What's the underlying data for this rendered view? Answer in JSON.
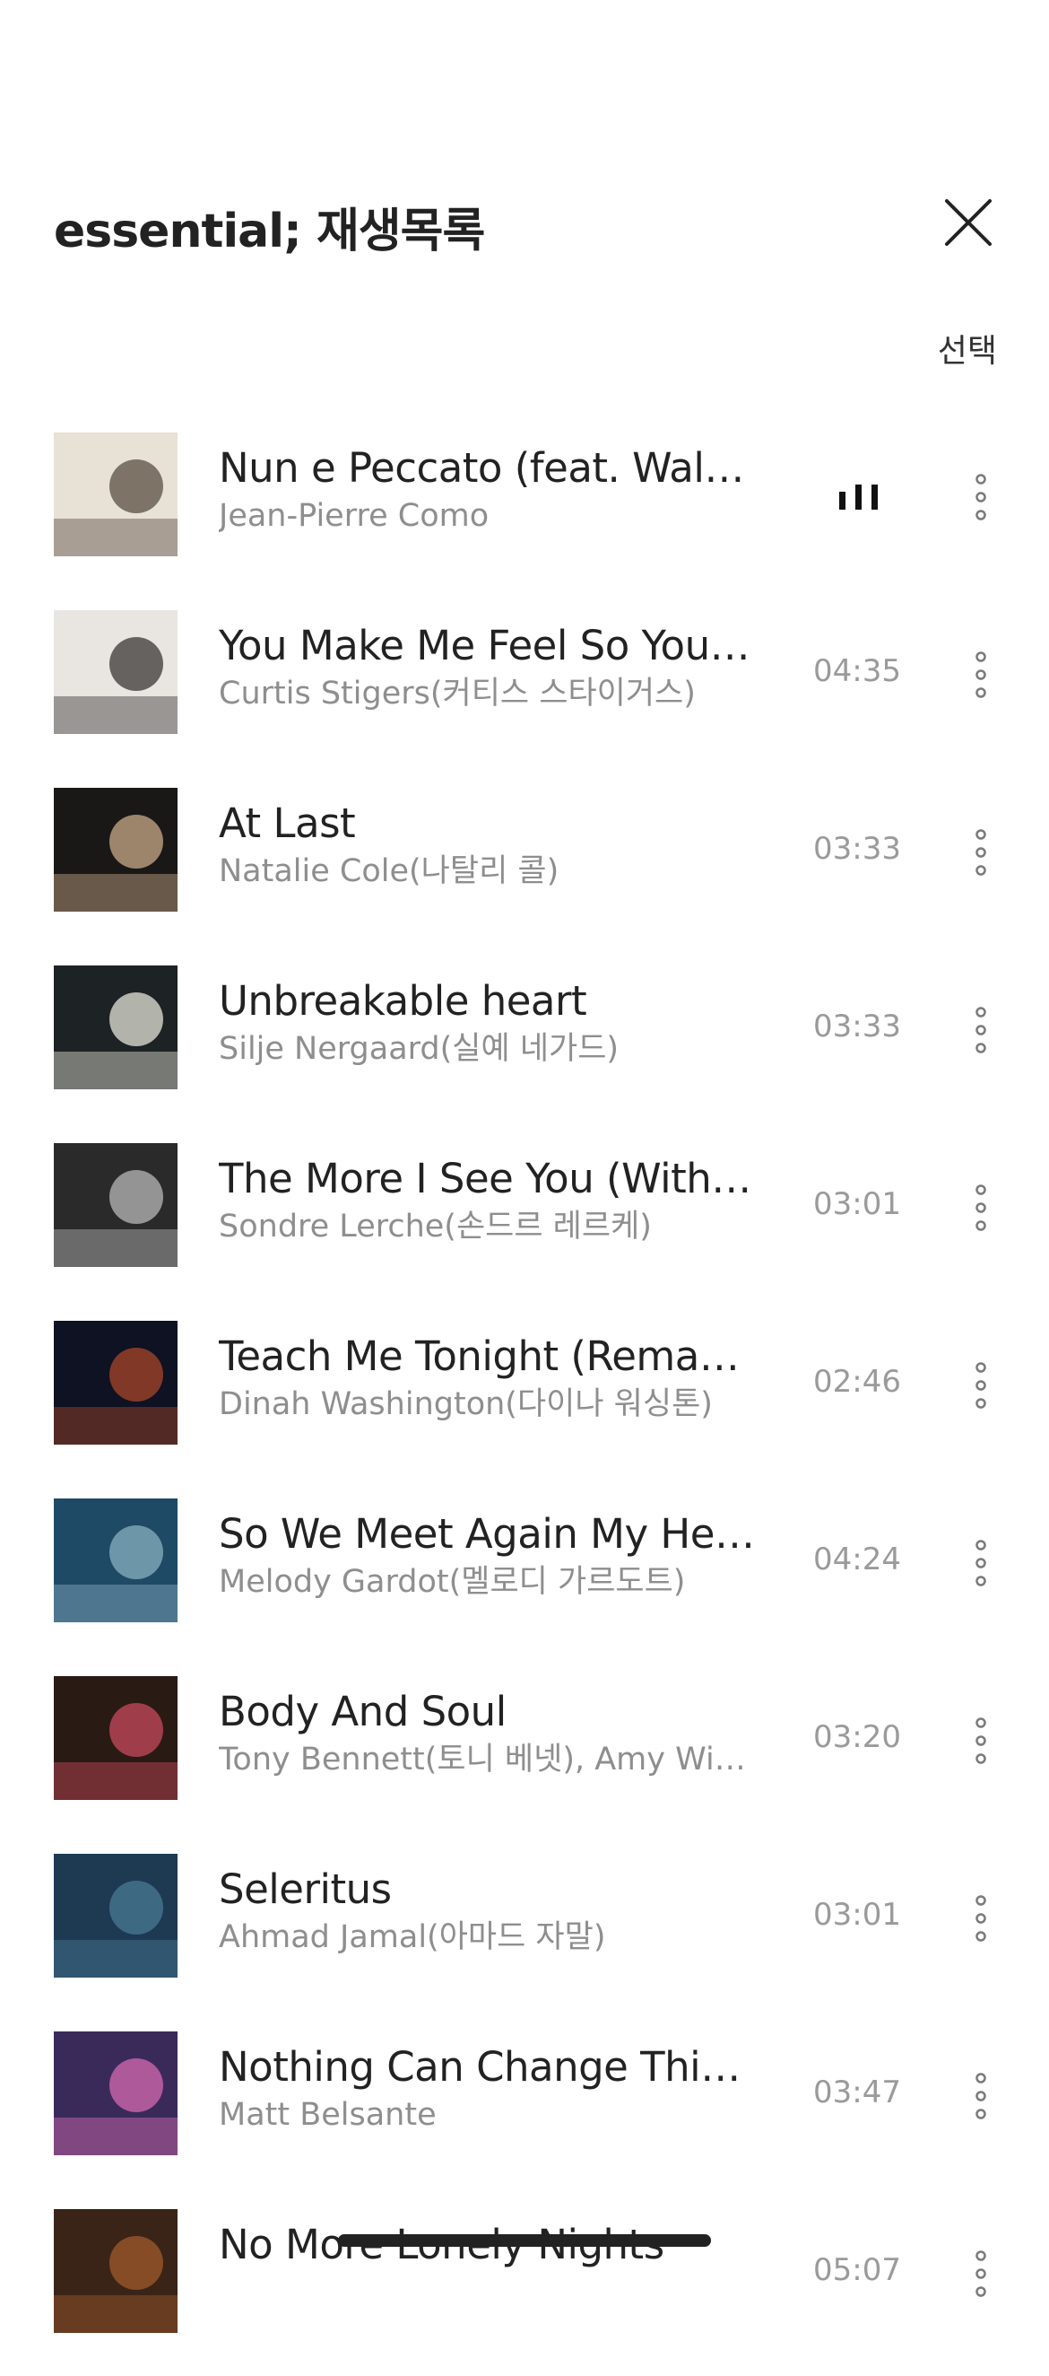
{
  "header": {
    "title": "essential; 재생목록",
    "select_label": "선택"
  },
  "tracks": [
    {
      "title": "Nun e Peccato (feat. Walte…",
      "artist": "Jean-Pierre Como",
      "duration": "",
      "playing": true,
      "cover_colors": [
        "#e8e1d6",
        "#5a4e42"
      ]
    },
    {
      "title": "You Make Me Feel So Young",
      "artist": "Curtis Stigers(커티스 스타이거스)",
      "duration": "04:35",
      "playing": false,
      "cover_colors": [
        "#e9e6e2",
        "#3a3633"
      ]
    },
    {
      "title": "At Last",
      "artist": "Natalie Cole(나탈리 콜)",
      "duration": "03:33",
      "playing": false,
      "cover_colors": [
        "#1a1816",
        "#c9a98a"
      ]
    },
    {
      "title": "Unbreakable heart",
      "artist": "Silje Nergaard(실예 네가드)",
      "duration": "03:33",
      "playing": false,
      "cover_colors": [
        "#1d2224",
        "#e4e4d8"
      ]
    },
    {
      "title": "The More I See You (With T…",
      "artist": "Sondre Lerche(손드르 레르케)",
      "duration": "03:01",
      "playing": false,
      "cover_colors": [
        "#2a2a2a",
        "#b8b8b8"
      ]
    },
    {
      "title": "Teach Me Tonight (Remast…",
      "artist": "Dinah Washington(다이나 워싱톤)",
      "duration": "02:46",
      "playing": false,
      "cover_colors": [
        "#0e1222",
        "#a8462a"
      ]
    },
    {
      "title": "So We Meet Again My Hea…",
      "artist": "Melody Gardot(멜로디 가르도트)",
      "duration": "04:24",
      "playing": false,
      "cover_colors": [
        "#1e4a66",
        "#8ab0c0"
      ]
    },
    {
      "title": "Body And Soul",
      "artist": "Tony Bennett(토니 베넷), Amy Win…",
      "duration": "03:20",
      "playing": false,
      "cover_colors": [
        "#2a1a14",
        "#c84a5c"
      ]
    },
    {
      "title": "Seleritus",
      "artist": "Ahmad Jamal(아마드 자말)",
      "duration": "03:01",
      "playing": false,
      "cover_colors": [
        "#1d3a52",
        "#4a7a94"
      ]
    },
    {
      "title": "Nothing Can Change This…",
      "artist": "Matt Belsante",
      "duration": "03:47",
      "playing": false,
      "cover_colors": [
        "#3a2a5a",
        "#d66ab0"
      ]
    },
    {
      "title": "No More Lonely Nights",
      "artist": "",
      "duration": "05:07",
      "playing": false,
      "cover_colors": [
        "#3a2418",
        "#a05a2a"
      ]
    }
  ],
  "colors": {
    "text_primary": "#222222",
    "text_secondary": "#8e8e8e",
    "background": "#ffffff"
  },
  "icons": {
    "close": "close-icon",
    "more": "more-vertical-icon",
    "playing": "equalizer-icon"
  }
}
